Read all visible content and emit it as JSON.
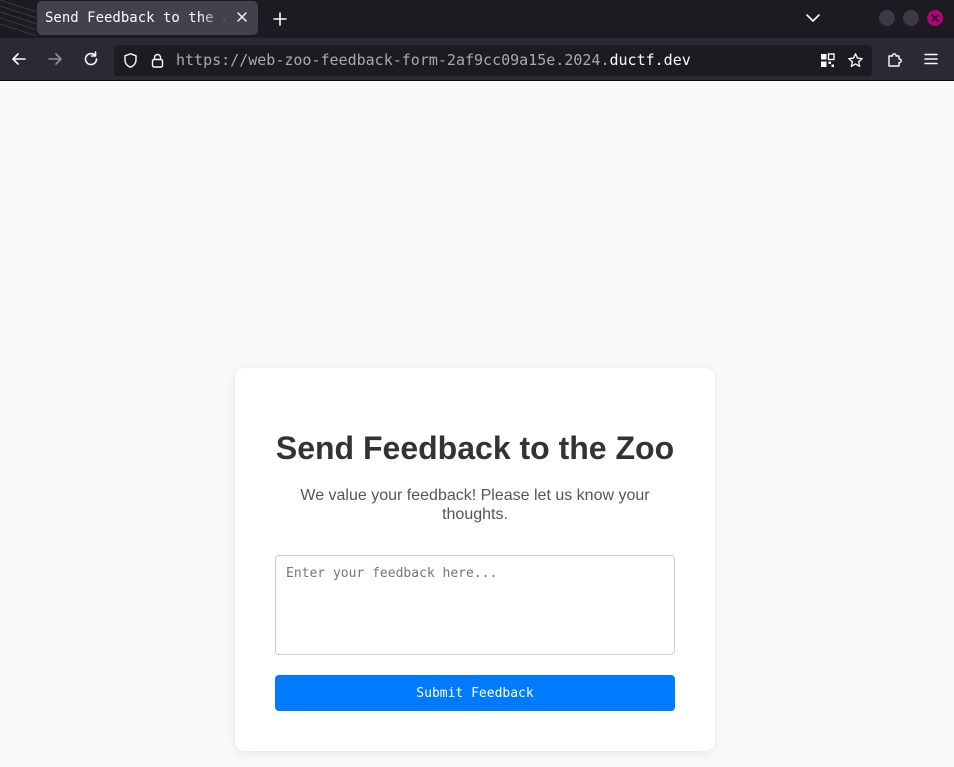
{
  "browser": {
    "tab_title": "Send Feedback to the Zoo",
    "url_prefix": "https://web-zoo-feedback-form-2af9cc09a15e.2024.",
    "url_domain": "ductf.dev"
  },
  "icons": {
    "tab_close": "close-icon",
    "new_tab": "plus-icon",
    "tab_list": "chevron-down-icon",
    "back": "arrow-left-icon",
    "forward": "arrow-right-icon",
    "reload": "reload-icon",
    "shield": "shield-icon",
    "lock": "lock-icon",
    "qr": "qr-code-icon",
    "bookmark": "star-icon",
    "extensions": "puzzle-icon",
    "menu": "hamburger-menu-icon"
  },
  "colors": {
    "accent": "#007bff",
    "window_close": "#b4007a"
  },
  "page": {
    "title": "Send Feedback to the Zoo",
    "subtitle": "We value your feedback! Please let us know your thoughts.",
    "textarea_placeholder": "Enter your feedback here...",
    "submit_label": "Submit Feedback"
  }
}
